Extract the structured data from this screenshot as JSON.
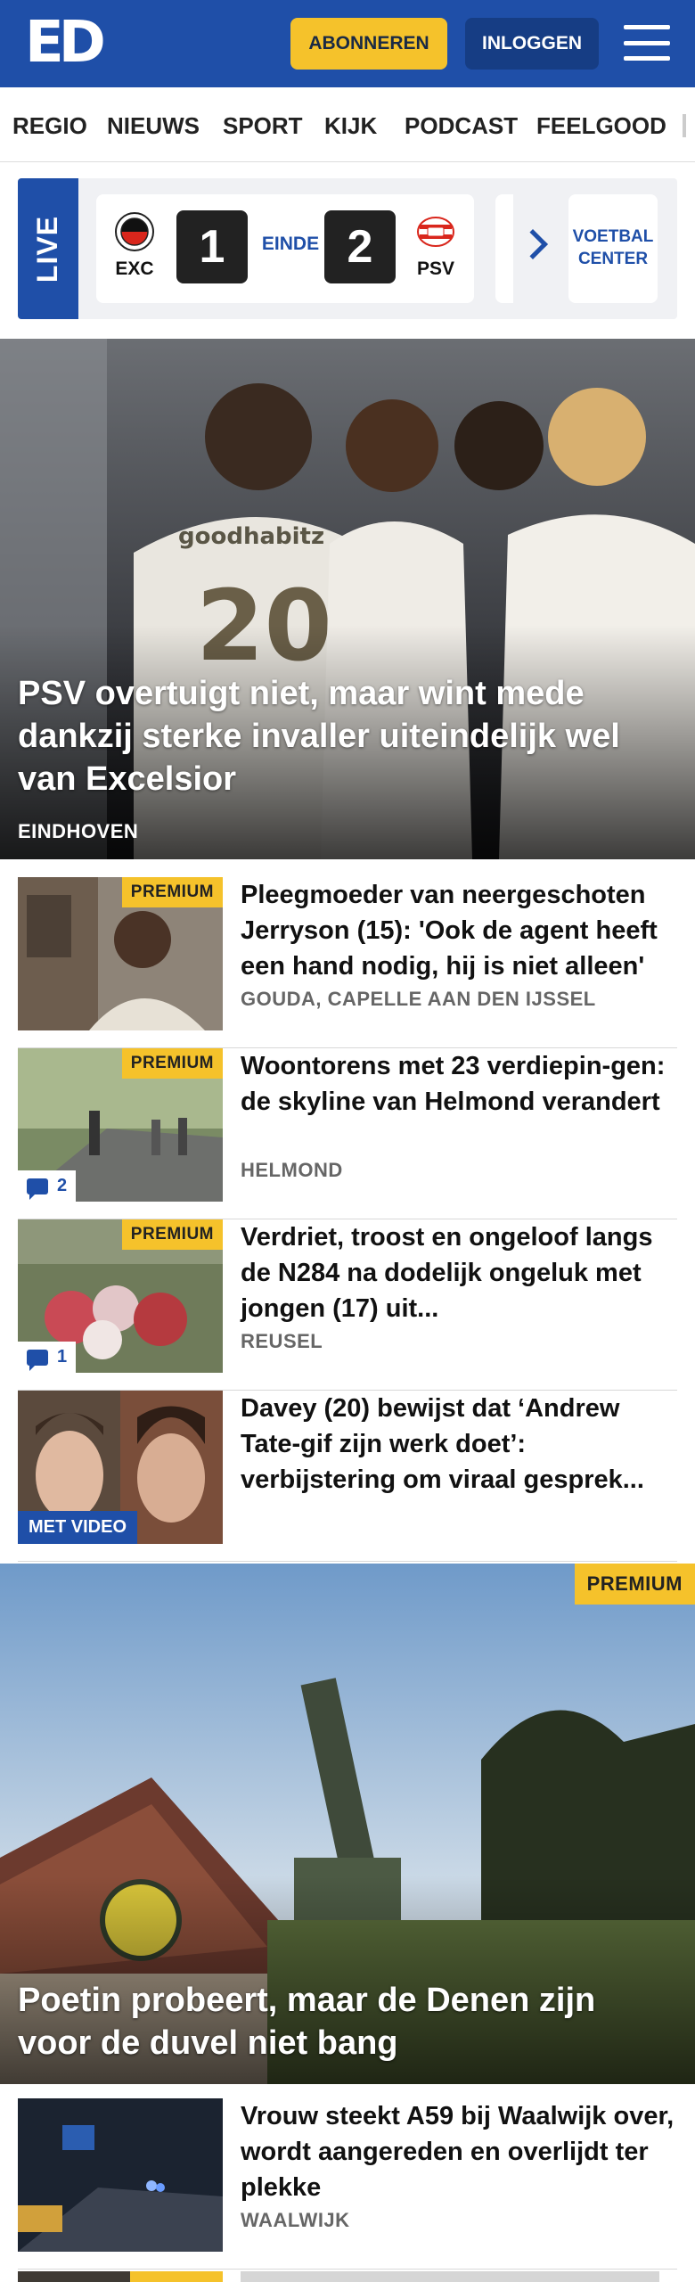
{
  "header": {
    "logo": "ED",
    "subscribe_label": "ABONNEREN",
    "login_label": "INLOGGEN"
  },
  "nav": {
    "items": [
      "REGIO",
      "NIEUWS",
      "SPORT",
      "KIJK",
      "PODCAST",
      "FEELGOOD"
    ]
  },
  "live": {
    "label": "LIVE",
    "match": {
      "home": "EXC",
      "away": "PSV",
      "home_score": "1",
      "away_score": "2",
      "status": "EINDE"
    },
    "voetbal_center": "VOETBAL CENTER"
  },
  "hero": {
    "title": "PSV overtuigt niet, maar wint mede dankzij sterke invaller uiteindelijk wel van Excelsior",
    "location": "EINDHOVEN"
  },
  "articles": [
    {
      "title": "Pleegmoeder van neergeschoten Jerryson (15): 'Ook de agent heeft een hand nodig, hij is niet alleen'",
      "location": "GOUDA, CAPELLE AAN DEN IJSSEL",
      "premium": "PREMIUM"
    },
    {
      "title": "Woontorens met 23 verdiepin-gen: de skyline van Helmond verandert",
      "location": "HELMOND",
      "premium": "PREMIUM",
      "comments": "2"
    },
    {
      "title": "Verdriet, troost en ongeloof langs de N284 na dodelijk ongeluk met jongen (17) uit...",
      "location": "REUSEL",
      "premium": "PREMIUM",
      "comments": "1"
    },
    {
      "title": "Davey (20) bewijst dat ‘Andrew Tate-gif zijn werk doet’: verbijstering om viraal gesprek...",
      "video": "MET VIDEO"
    }
  ],
  "feature": {
    "title": "Poetin probeert, maar de Denen zijn voor de duvel niet bang",
    "premium": "PREMIUM"
  },
  "article_after": {
    "title": "Vrouw steekt A59 bij Waalwijk over, wordt aangereden en overlijdt ter plekke",
    "location": "WAALWIJK"
  },
  "colors": {
    "brand_blue": "#1f4fa8",
    "premium_yellow": "#f5c22b"
  }
}
